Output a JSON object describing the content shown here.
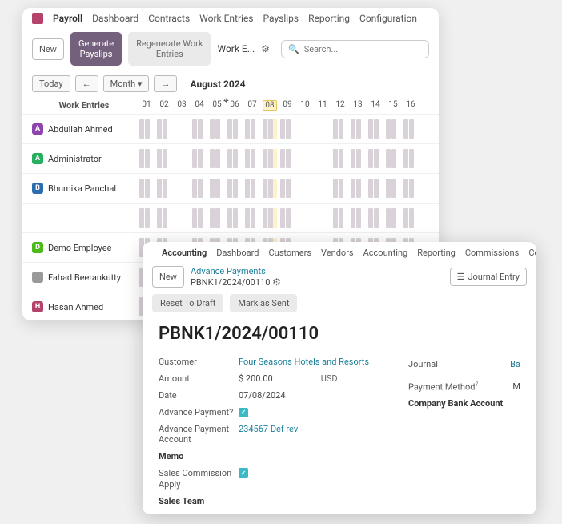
{
  "payroll": {
    "module": "Payroll",
    "nav": [
      "Dashboard",
      "Contracts",
      "Work Entries",
      "Payslips",
      "Reporting",
      "Configuration"
    ],
    "toolbar": {
      "new": "New",
      "generate": "Generate\nPayslips",
      "regenerate": "Regenerate Work\nEntries",
      "breadcrumb": "Work E...",
      "search_placeholder": "Search..."
    },
    "controls": {
      "today": "Today",
      "period": "Month",
      "period_label": "August 2024"
    },
    "grid": {
      "header": "Work Entries",
      "days": [
        "01",
        "02",
        "03",
        "04",
        "05",
        "06",
        "07",
        "08",
        "09",
        "10",
        "11",
        "12",
        "13",
        "14",
        "15",
        "16"
      ],
      "highlight_day": "08",
      "employees": [
        {
          "initial": "A",
          "color": "av-purple",
          "name": "Abdullah Ahmed",
          "rows": 1
        },
        {
          "initial": "A",
          "color": "av-green",
          "name": "Administrator",
          "rows": 1
        },
        {
          "initial": "B",
          "color": "av-blue",
          "name": "Bhumika Panchal",
          "rows": 2
        },
        {
          "initial": "D",
          "color": "av-lime",
          "name": "Demo Employee",
          "rows": 1
        },
        {
          "initial": "",
          "color": "av-img",
          "name": "Fahad Beerankutty",
          "rows": 1
        },
        {
          "initial": "H",
          "color": "av-mag",
          "name": "Hasan Ahmed",
          "rows": 1
        }
      ]
    }
  },
  "accounting": {
    "module": "Accounting",
    "nav": [
      "Dashboard",
      "Customers",
      "Vendors",
      "Accounting",
      "Reporting",
      "Commissions",
      "Configuration"
    ],
    "toolbar": {
      "new": "New",
      "breadcrumb_link": "Advance Payments",
      "breadcrumb_id": "PBNK1/2024/00110",
      "journal_entry": "Journal Entry"
    },
    "actions": {
      "reset": "Reset To Draft",
      "mark_sent": "Mark as Sent"
    },
    "doc_title": "PBNK1/2024/00110",
    "fields": {
      "customer_label": "Customer",
      "customer_value": "Four Seasons Hotels and Resorts",
      "amount_label": "Amount",
      "amount_value": "$ 200.00",
      "currency": "USD",
      "date_label": "Date",
      "date_value": "07/08/2024",
      "adv_pay_label": "Advance Payment?",
      "adv_acct_label": "Advance Payment Account",
      "adv_acct_value": "234567 Def rev",
      "memo_label": "Memo",
      "sales_comm_label": "Sales Commission Apply",
      "sales_team_label": "Sales Team"
    },
    "right": {
      "journal_label": "Journal",
      "journal_value": "Ba",
      "pmethod_label": "Payment Method",
      "pmethod_value": "M",
      "bank_label": "Company Bank Account"
    }
  }
}
